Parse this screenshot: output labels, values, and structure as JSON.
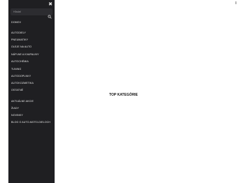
{
  "sidebar": {
    "close_icon": "close-icon",
    "search": {
      "placeholder": "Hľadať",
      "icon": "search-icon"
    },
    "items": [
      {
        "label": "DOMOV"
      },
      {
        "label": "AUTODIELY"
      },
      {
        "label": "PNEUMATIKY"
      },
      {
        "label": "OLEJE NA AUTO"
      },
      {
        "label": "NÁPLNE A KVAPALINY"
      },
      {
        "label": "AUTOCHÉMIA"
      },
      {
        "label": "TUNING"
      },
      {
        "label": "AUTODOPLNKY"
      },
      {
        "label": "AUTOKOZMETIKA"
      },
      {
        "label": "OSTATNÉ"
      },
      {
        "label": "AKTUÁLNE AKCIE"
      },
      {
        "label": "ŽIADY"
      },
      {
        "label": "NOVINKY"
      },
      {
        "label": "BLOG O AUTO-MOTO-DIELOCH"
      }
    ]
  },
  "main": {
    "heading": "TOP KATEGÓRIE"
  },
  "colors": {
    "sidebar_bg": "#1f1f22",
    "sidebar_text": "#e9e9e9",
    "page_bg": "#ffffff"
  }
}
